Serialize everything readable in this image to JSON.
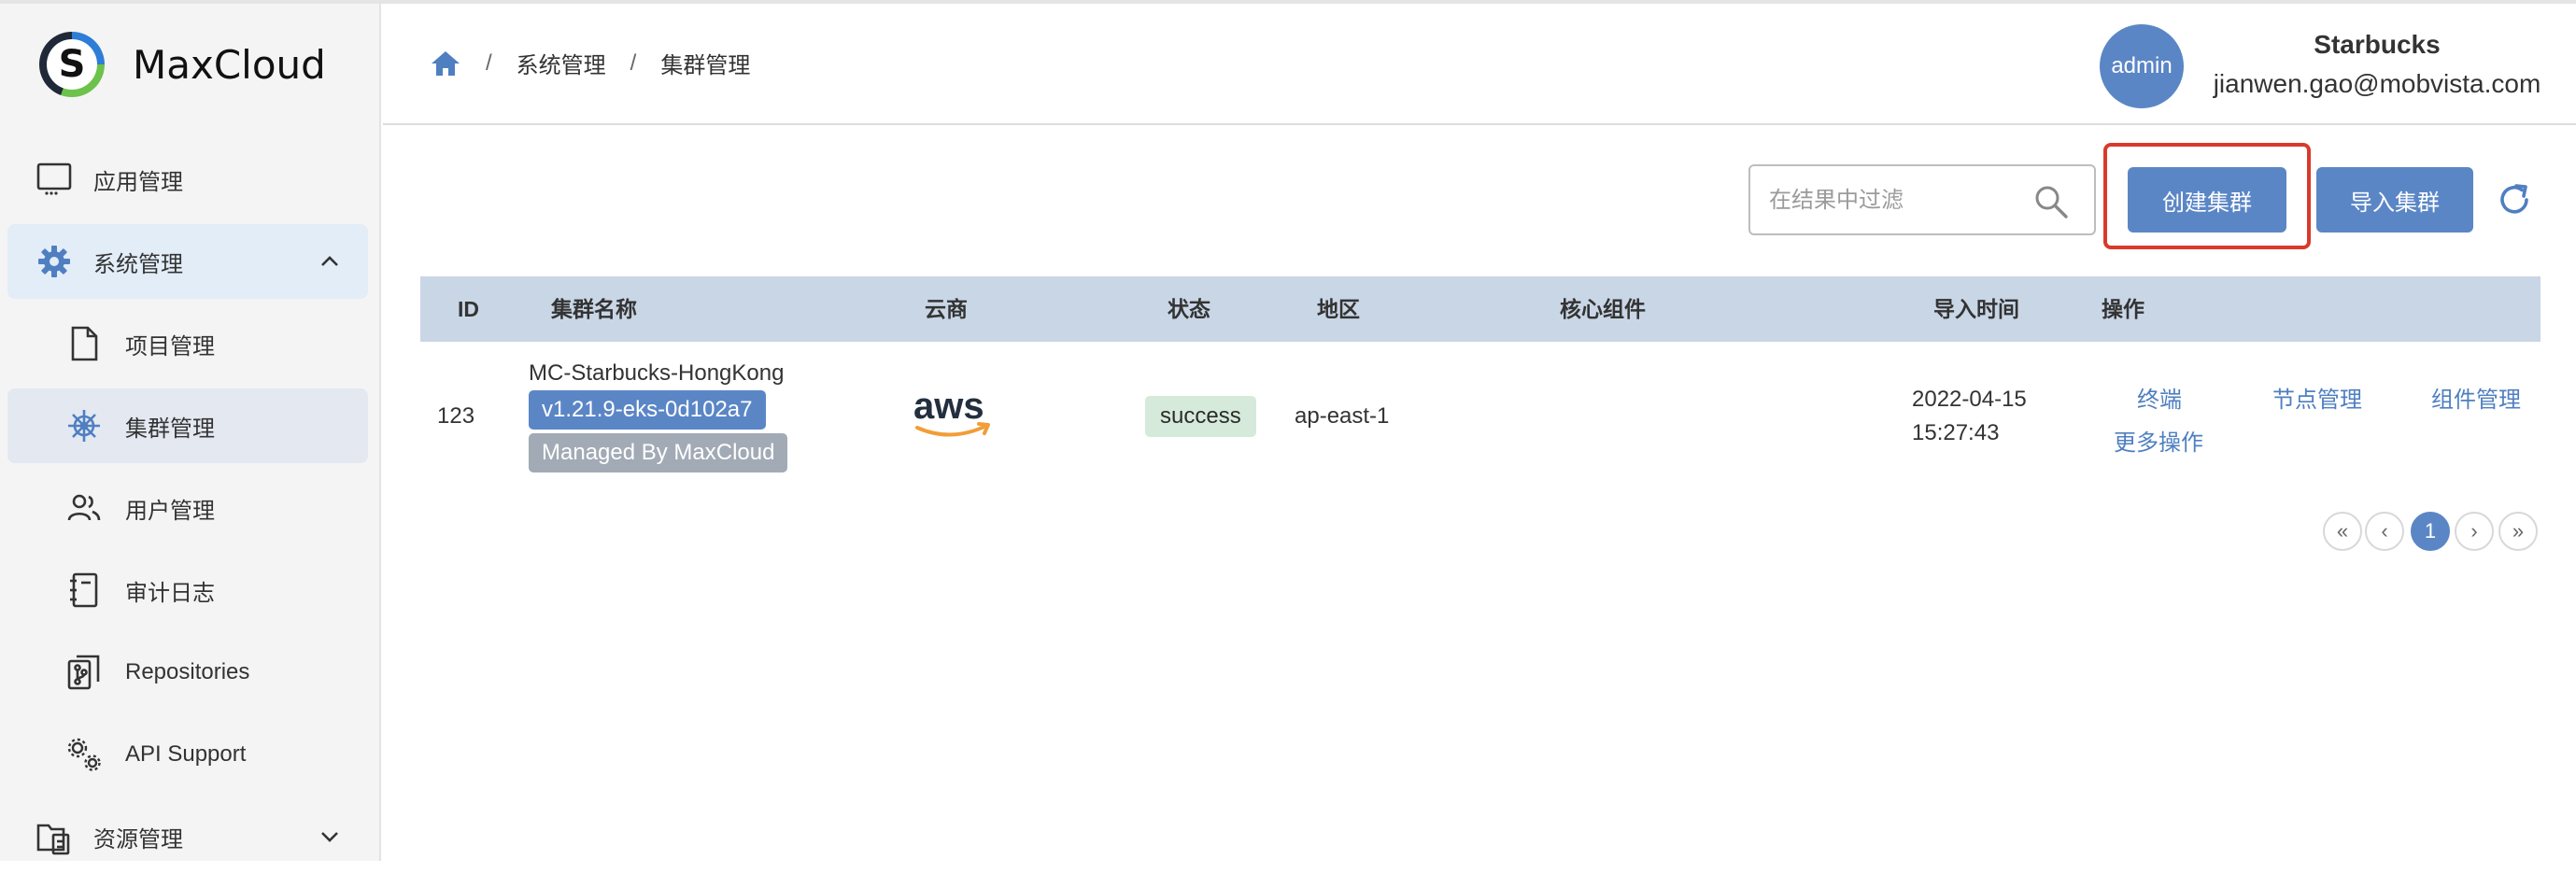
{
  "app": {
    "name": "MaxCloud",
    "logo_letter": "S"
  },
  "sidebar": {
    "items": [
      {
        "label": "应用管理",
        "icon": "monitor-icon",
        "level": "top"
      },
      {
        "label": "系统管理",
        "icon": "gear-icon",
        "level": "top",
        "expanded": true
      },
      {
        "label": "项目管理",
        "icon": "document-icon",
        "level": "sub"
      },
      {
        "label": "集群管理",
        "icon": "helm-icon",
        "level": "sub",
        "active": true
      },
      {
        "label": "用户管理",
        "icon": "users-icon",
        "level": "sub"
      },
      {
        "label": "审计日志",
        "icon": "notebook-icon",
        "level": "sub"
      },
      {
        "label": "Repositories",
        "icon": "repo-icon",
        "level": "sub"
      },
      {
        "label": "API Support",
        "icon": "gears-icon",
        "level": "sub"
      },
      {
        "label": "资源管理",
        "icon": "resource-icon",
        "level": "top",
        "expanded": false
      }
    ]
  },
  "breadcrumb": {
    "items": [
      "系统管理",
      "集群管理"
    ],
    "separator": "/"
  },
  "user": {
    "avatar_text": "admin",
    "name": "Starbucks",
    "email": "jianwen.gao@mobvista.com"
  },
  "toolbar": {
    "search_placeholder": "在结果中过滤",
    "create_label": "创建集群",
    "import_label": "导入集群"
  },
  "table": {
    "headers": [
      "ID",
      "集群名称",
      "云商",
      "状态",
      "地区",
      "核心组件",
      "导入时间",
      "操作"
    ],
    "rows": [
      {
        "id": "123",
        "name": "MC-Starbucks-HongKong",
        "version": "v1.21.9-eks-0d102a7",
        "managed": "Managed By MaxCloud",
        "provider": "aws",
        "status": "success",
        "region": "ap-east-1",
        "core_components": "",
        "import_date": "2022-04-15",
        "import_time": "15:27:43",
        "actions": [
          "终端",
          "节点管理",
          "组件管理",
          "更多操作"
        ]
      }
    ]
  },
  "pagination": {
    "first": "«",
    "prev": "‹",
    "current": "1",
    "next": "›",
    "last": "»"
  },
  "colors": {
    "primary": "#5b86c6",
    "header_bg": "#c9d6e6",
    "highlight": "#d93a2b",
    "success_bg": "#d5eadb"
  }
}
